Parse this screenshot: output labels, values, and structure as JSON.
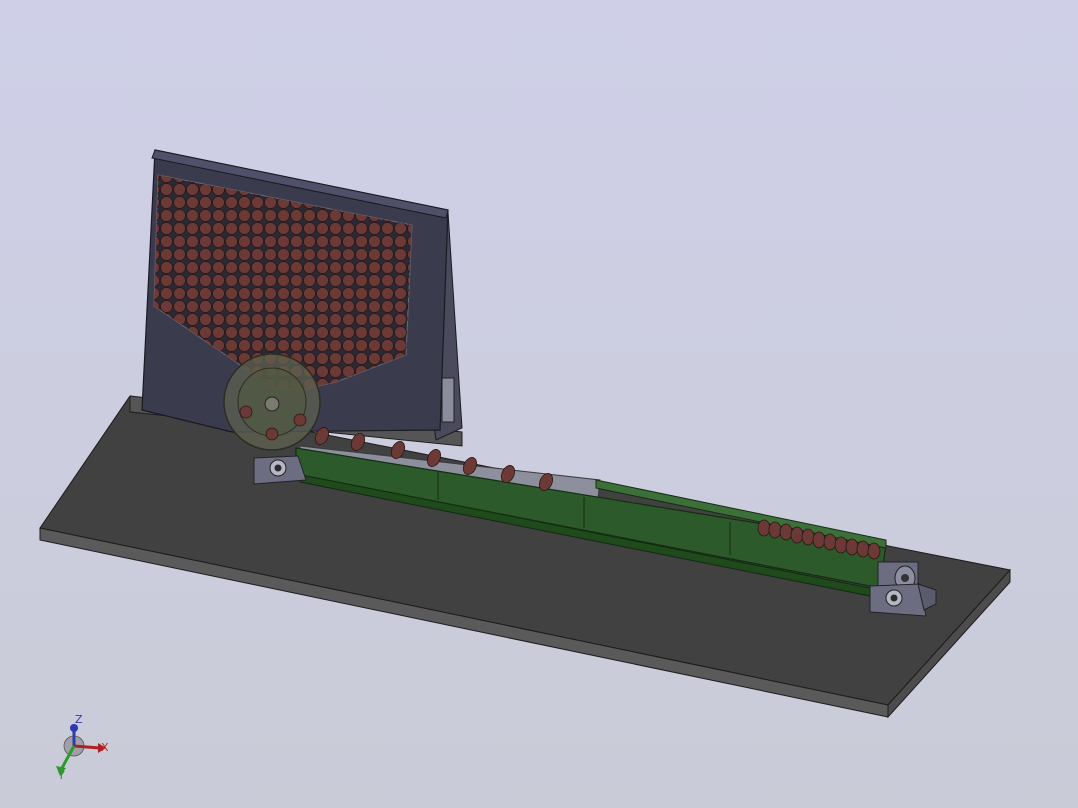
{
  "viewport": {
    "colors": {
      "background_top": "#cfd0e8",
      "background_bottom": "#c9cbd7",
      "base_plate": "#3f3f3f",
      "hopper_body": "#3b3b4e",
      "balls": "#6b3a36",
      "conveyor": "#2d5a2a",
      "bearing_blocks": "#6c6d80"
    }
  },
  "triad": {
    "z_label": "Z",
    "x_label": "X",
    "y_label": "Y",
    "z_color": "#2d3ab0",
    "x_color": "#b02020",
    "y_color": "#2c9a2c"
  }
}
